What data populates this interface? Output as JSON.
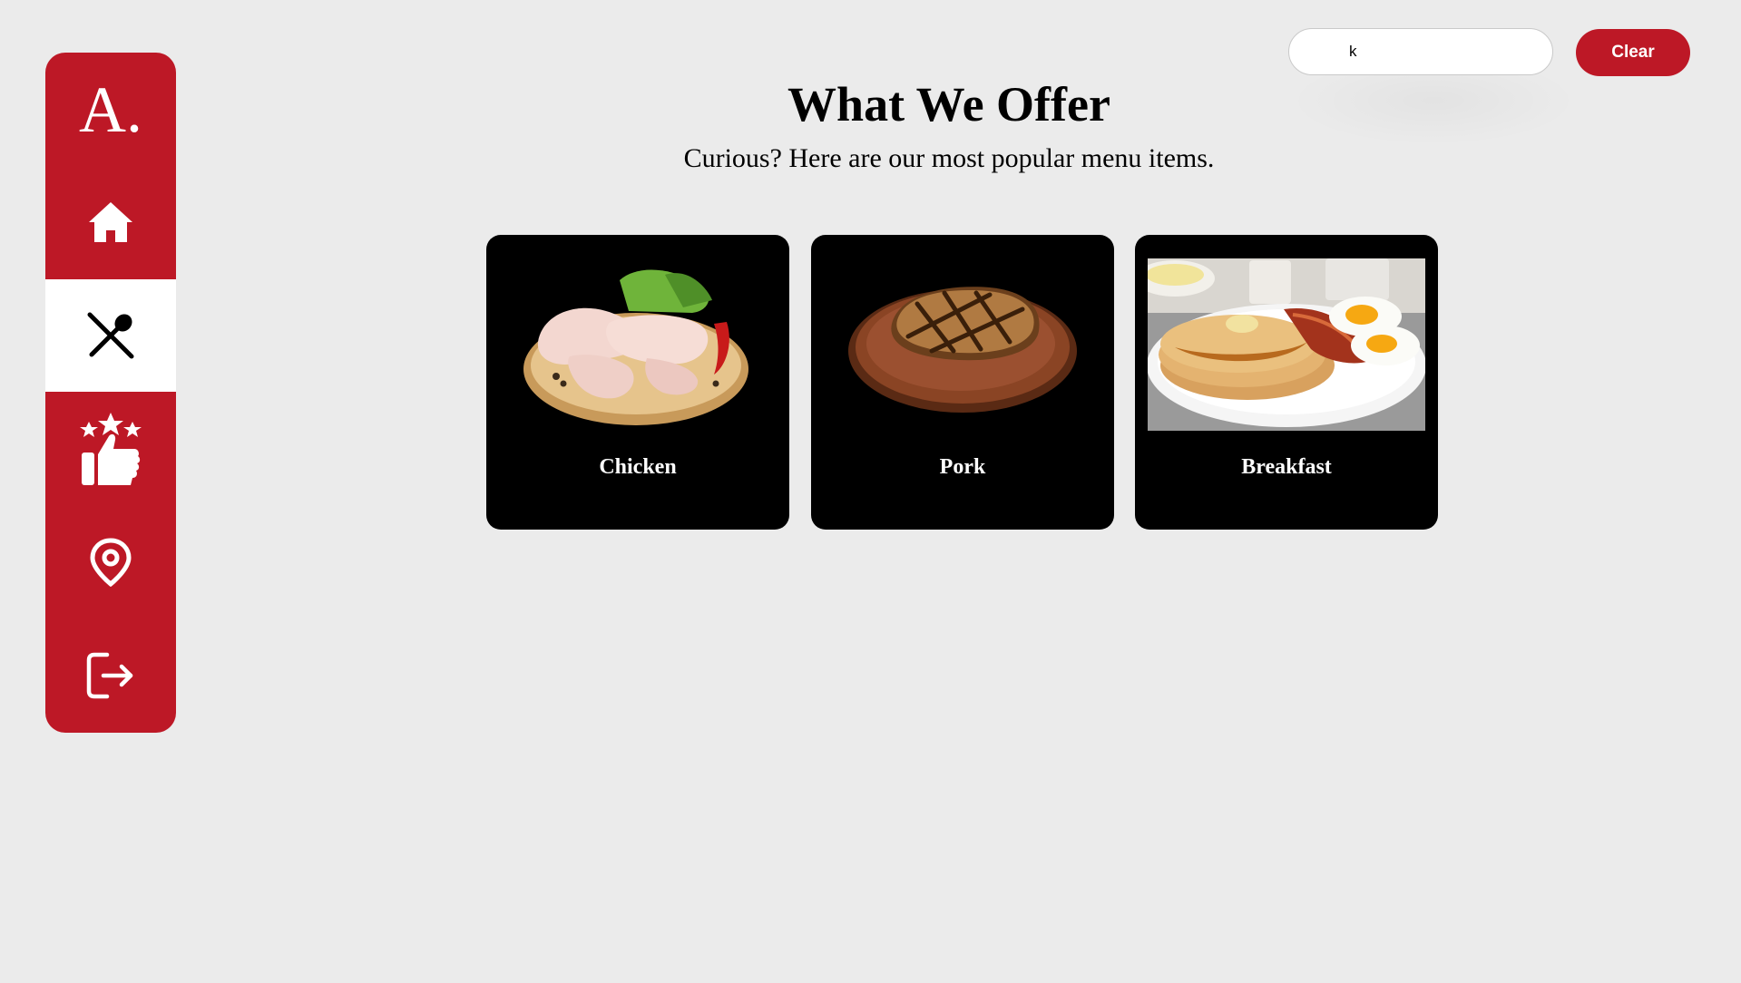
{
  "sidebar": {
    "logo": "A.",
    "items": [
      {
        "name": "home",
        "icon": "home-icon"
      },
      {
        "name": "menu",
        "icon": "fork-spoon-icon",
        "active": true
      },
      {
        "name": "reviews",
        "icon": "thumbs-up-stars-icon"
      },
      {
        "name": "location",
        "icon": "map-pin-icon"
      },
      {
        "name": "logout",
        "icon": "logout-icon"
      }
    ]
  },
  "search": {
    "value": "k",
    "placeholder": ""
  },
  "toolbar": {
    "clear_label": "Clear"
  },
  "main": {
    "title": "What We Offer",
    "subtitle": "Curious? Here are our most popular menu items."
  },
  "cards": [
    {
      "label": "Chicken",
      "image": "raw-chicken-legs-on-board"
    },
    {
      "label": "Pork",
      "image": "grilled-pork-chop-on-board"
    },
    {
      "label": "Breakfast",
      "image": "pancakes-bacon-eggs-plate"
    }
  ],
  "colors": {
    "brand_red": "#bd1826",
    "background": "#ebebeb",
    "card_background": "#000000"
  }
}
